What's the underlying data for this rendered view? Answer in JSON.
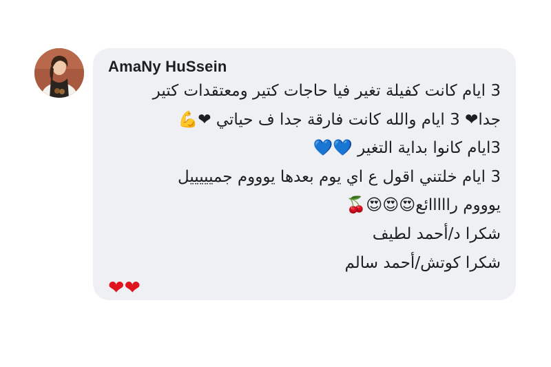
{
  "comment": {
    "author": "AmaNy HuSsein",
    "lines": [
      "3 ايام كانت كفيلة تغير فيا حاجات كتير ومعتقدات كتير",
      "جدا❤ 3 ايام والله كانت فارقة جدا ف حياتي ❤💪",
      "3ايام كانوا بداية التغير 💙💙",
      "3 ايام خلتني اقول ع اي يوم بعدها يوووم جميييييل",
      "يوووم رااااائع😍😍😍🍒",
      "شكرا د/أحمد لطيف",
      "شكرا كوتش/أحمد سالم"
    ],
    "trailing_emoji": "❤❤"
  },
  "colors": {
    "bubble_background": "#eff0f4",
    "text": "#1c1e21",
    "heart": "#e0141e"
  },
  "icons": {
    "avatar": "profile-photo"
  }
}
